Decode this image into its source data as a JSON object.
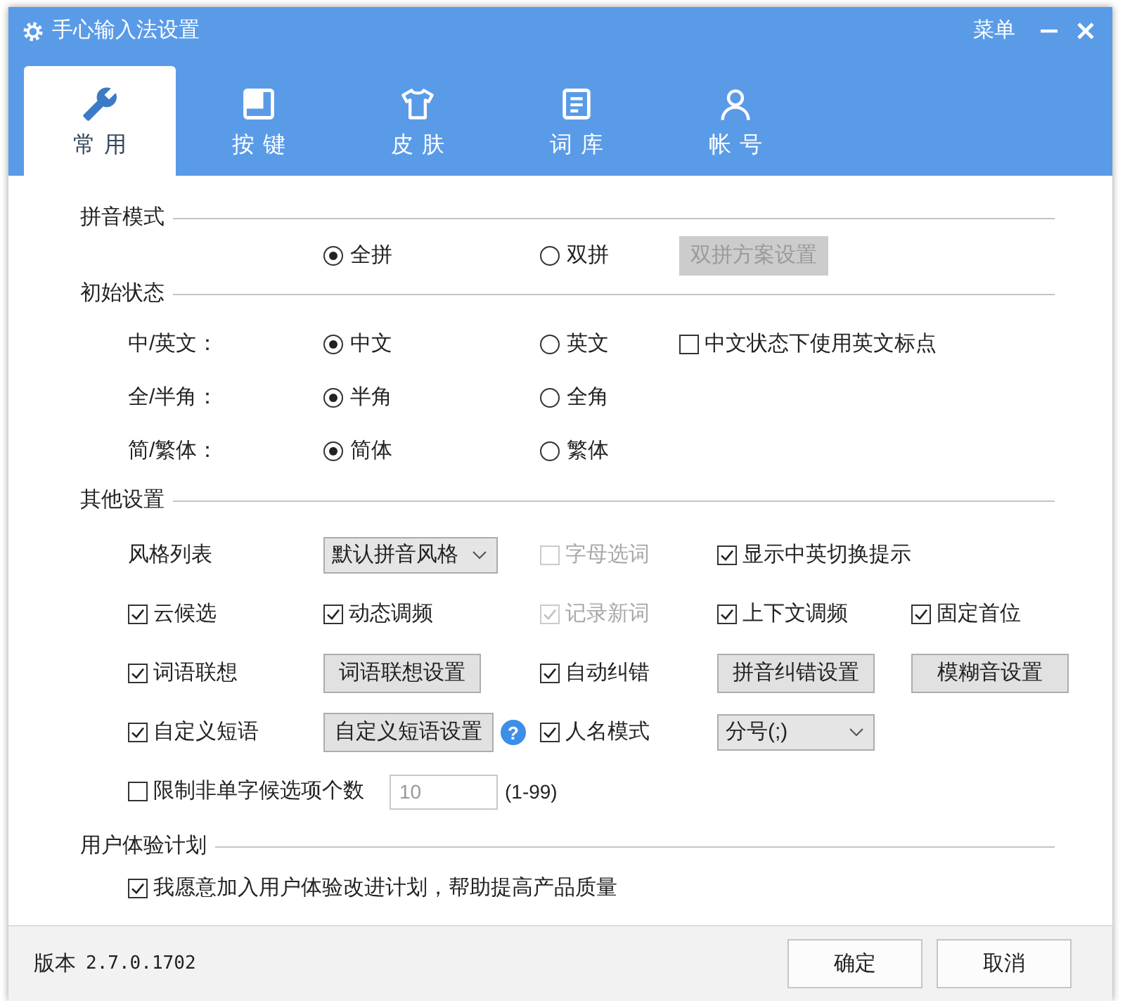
{
  "window": {
    "title": "手心输入法设置",
    "menu": "菜单"
  },
  "tabs": [
    {
      "label": "常用",
      "selected": true
    },
    {
      "label": "按键",
      "selected": false
    },
    {
      "label": "皮肤",
      "selected": false
    },
    {
      "label": "词库",
      "selected": false
    },
    {
      "label": "帐号",
      "selected": false
    }
  ],
  "sections": [
    {
      "title": "拼音模式",
      "rows": [
        {
          "cells": [
            [
              {
                "kind": "radio",
                "label": "全拼",
                "selected": true
              }
            ],
            [
              {
                "kind": "radio",
                "label": "双拼",
                "selected": false
              }
            ],
            [
              {
                "kind": "button",
                "label": "双拼方案设置",
                "disabled": true
              }
            ]
          ]
        }
      ]
    },
    {
      "title": "初始状态",
      "rows": [
        {
          "cells": [
            [
              {
                "kind": "label",
                "text": "中/英文："
              }
            ],
            [
              {
                "kind": "radio",
                "label": "中文",
                "selected": true
              }
            ],
            [
              {
                "kind": "radio",
                "label": "英文",
                "selected": false
              }
            ],
            [
              {
                "kind": "checkbox",
                "label": "中文状态下使用英文标点",
                "checked": false,
                "disabled": false
              }
            ]
          ]
        },
        {
          "cells": [
            [
              {
                "kind": "label",
                "text": "全/半角："
              }
            ],
            [
              {
                "kind": "radio",
                "label": "半角",
                "selected": true
              }
            ],
            [
              {
                "kind": "radio",
                "label": "全角",
                "selected": false
              }
            ]
          ]
        },
        {
          "cells": [
            [
              {
                "kind": "label",
                "text": "简/繁体："
              }
            ],
            [
              {
                "kind": "radio",
                "label": "简体",
                "selected": true
              }
            ],
            [
              {
                "kind": "radio",
                "label": "繁体",
                "selected": false
              }
            ]
          ]
        }
      ]
    },
    {
      "title": "其他设置",
      "rows": [
        {
          "cells": [
            [
              {
                "kind": "label",
                "text": "风格列表"
              }
            ],
            [
              {
                "kind": "select",
                "value": "默认拼音风格"
              }
            ],
            [
              {
                "kind": "checkbox",
                "label": "字母选词",
                "checked": false,
                "disabled": true
              }
            ],
            [
              {
                "kind": "checkbox",
                "label": "显示中英切换提示",
                "checked": true,
                "disabled": false
              }
            ]
          ]
        },
        {
          "cells": [
            [
              {
                "kind": "checkbox",
                "label": "云候选",
                "checked": true,
                "disabled": false
              }
            ],
            [
              {
                "kind": "checkbox",
                "label": "动态调频",
                "checked": true,
                "disabled": false
              }
            ],
            [
              {
                "kind": "checkbox",
                "label": "记录新词",
                "checked": true,
                "disabled": true
              }
            ],
            [
              {
                "kind": "checkbox",
                "label": "上下文调频",
                "checked": true,
                "disabled": false
              }
            ],
            [
              {
                "kind": "checkbox",
                "label": "固定首位",
                "checked": true,
                "disabled": false
              }
            ]
          ]
        },
        {
          "cells": [
            [
              {
                "kind": "checkbox",
                "label": "词语联想",
                "checked": true,
                "disabled": false
              }
            ],
            [
              {
                "kind": "button",
                "label": "词语联想设置",
                "disabled": false
              }
            ],
            [
              {
                "kind": "checkbox",
                "label": "自动纠错",
                "checked": true,
                "disabled": false
              }
            ],
            [
              {
                "kind": "button",
                "label": "拼音纠错设置",
                "disabled": false
              }
            ],
            [
              {
                "kind": "button",
                "label": "模糊音设置",
                "disabled": false
              }
            ]
          ]
        },
        {
          "cells": [
            [
              {
                "kind": "checkbox",
                "label": "自定义短语",
                "checked": true,
                "disabled": false
              }
            ],
            [
              {
                "kind": "button",
                "label": "自定义短语设置",
                "disabled": false
              },
              {
                "kind": "help",
                "text": "?"
              }
            ],
            [
              {
                "kind": "checkbox",
                "label": "人名模式",
                "checked": true,
                "disabled": false
              }
            ],
            [
              {
                "kind": "select",
                "value": "分号(;)"
              }
            ]
          ]
        },
        {
          "cells": [
            [
              {
                "kind": "checkbox",
                "label": "限制非单字候选项个数",
                "checked": false,
                "disabled": false
              },
              {
                "kind": "input",
                "value": "10",
                "disabled": true
              },
              {
                "kind": "text",
                "text": "(1-99)"
              }
            ]
          ]
        }
      ]
    },
    {
      "title": "用户体验计划",
      "rows": [
        {
          "cells": [
            [
              {
                "kind": "checkbox",
                "label": "我愿意加入用户体验改进计划，帮助提高产品质量",
                "checked": true,
                "disabled": false
              }
            ]
          ]
        }
      ]
    }
  ],
  "footer": {
    "version_label": "版本",
    "version": "2.7.0.1702",
    "buttons": [
      "确定",
      "取消"
    ]
  }
}
